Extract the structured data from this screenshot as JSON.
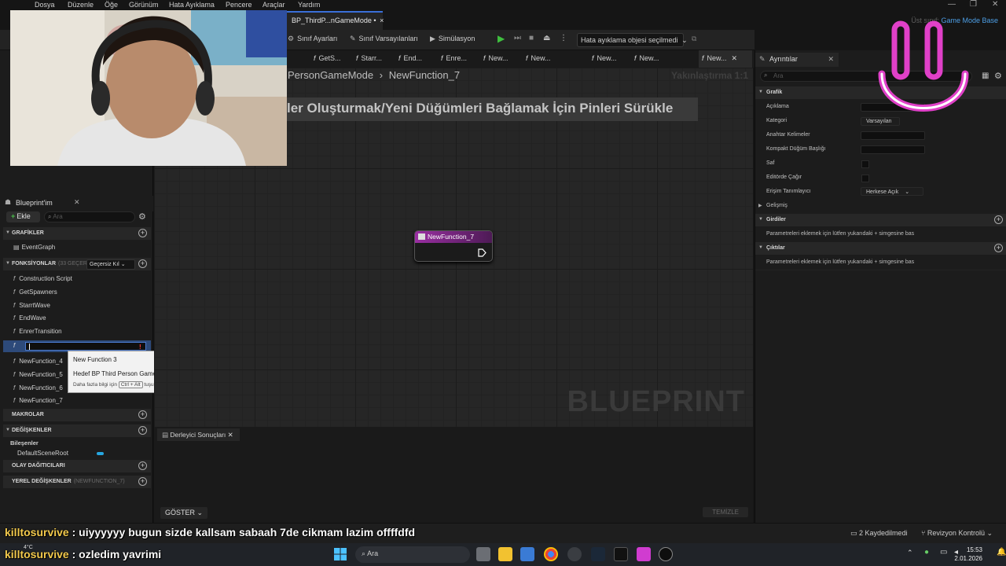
{
  "menu": [
    "Dosya",
    "Düzenle",
    "Öğe",
    "Görünüm",
    "Hata Ayıklama",
    "Pencere",
    "Araçlar",
    "Yardım"
  ],
  "doc_tab": {
    "label": "BP_ThirdP...nGameMode •",
    "close": "×"
  },
  "parent_class": {
    "label": "Üst sınıf:",
    "value": "Game Mode Base"
  },
  "toolbar": {
    "class_settings": "Sınıf Ayarları",
    "class_defaults": "Sınıf Varsayılanları",
    "simulation": "Simülasyon",
    "debug_object": "Hata ayıklama objesi seçilmedi"
  },
  "graph_tabs": [
    "GetS...",
    "Starr...",
    "End...",
    "Enre...",
    "New...",
    "New...",
    "New...",
    "New...",
    "New..."
  ],
  "blueprint_panel": {
    "tab_label": "Blueprint'im",
    "add_label": "Ekle",
    "search_placeholder": "Ara",
    "sections": {
      "graphs": "GRAFİKLER",
      "functions": "FONKSİYONLAR",
      "functions_sub": "(33 GEÇERS",
      "macros": "MAKROLAR",
      "variables": "DEĞİŞKENLER",
      "dispatchers": "OLAY DAĞITICILARI",
      "locals": "YEREL DEĞİŞKENLER",
      "locals_sub": "(NEWFUNCTION_7)"
    },
    "override_label": "Geçersiz Kıl",
    "graph_items": [
      "EventGraph"
    ],
    "functions": [
      "Construction Script",
      "GetSpawners",
      "StarrtWave",
      "EndWave",
      "EnrerTransition"
    ],
    "functions_after": [
      "NewFunction_4",
      "NewFunction_5",
      "NewFunction_6",
      "NewFunction_7"
    ],
    "components_label": "Bileşenler",
    "component": "DefaultSceneRoot"
  },
  "tooltip": {
    "line1": "New Function 3",
    "line2": "Hedef BP Third Person Game Mode",
    "line3_pre": "Daha fazla bilgi için",
    "line3_key": "Ctrl + Alt",
    "line3_post": "tuşunu basılı tut"
  },
  "graph": {
    "breadcrumb": "PersonGameMode",
    "breadcrumb_current": "NewFunction_7",
    "zoom": "Yakınlaştırma 1:1",
    "drag_hint": "ler Oluşturmak/Yeni Düğümleri Bağlamak İçin Pinleri Sürükle",
    "watermark": "BLUEPRINT",
    "node_title": "NewFunction_7"
  },
  "compiler": {
    "tab_label": "Derleyici Sonuçları",
    "show": "GÖSTER",
    "clear": "TEMİZLE"
  },
  "details": {
    "tab_label": "Ayrıntılar",
    "search_placeholder": "Ara",
    "section_graphic": "Grafik",
    "rows": {
      "description": "Açıklama",
      "category": "Kategori",
      "category_value": "Varsayılan",
      "keywords": "Anahtar Kelimeler",
      "compact_title": "Kompakt Düğüm Başlığı",
      "pure": "Saf",
      "call_in_editor": "Editörde Çağır",
      "access": "Erişim Tanımlayıcı",
      "access_value": "Herkese Açık"
    },
    "advanced": "Gelişmiş",
    "inputs": "Girdiler",
    "inputs_hint": "Parametreleri eklemek için lütfen yukarıdaki + simgesine bas",
    "outputs": "Çıktılar",
    "outputs_hint": "Parametreleri eklemek için lütfen yukarıdaki + simgesine bas"
  },
  "statusbar": {
    "saved": "2 Kaydedilmedi",
    "revision": "Revizyon Kontrolü"
  },
  "chat": [
    {
      "user": "killtosurvive",
      "message": ": uiyyyyyy bugun sizde kallsam sabaah 7de cikmam lazim offffdfd"
    },
    {
      "user": "killtosurvive",
      "message": ": ozledim yavrimi"
    }
  ],
  "taskbar": {
    "search": "Ara",
    "time": "15:53",
    "date": "2.01.2026",
    "weather": "4°C"
  },
  "colors": {
    "accent": "#3a6fd8",
    "function_node": "#9a2fa2",
    "chat_user": "#f2c94c",
    "overlay": "#e040c8"
  }
}
